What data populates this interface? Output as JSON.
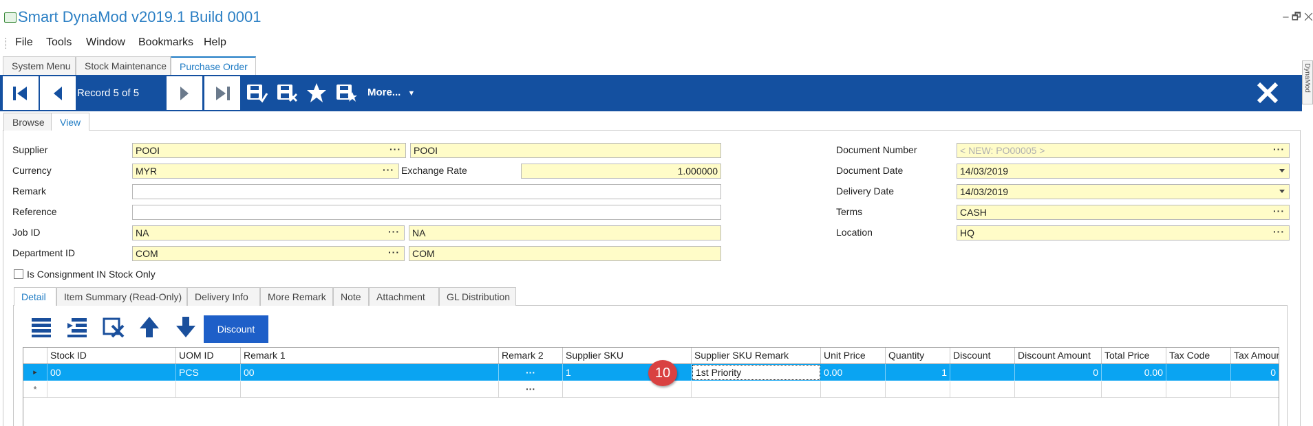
{
  "app": {
    "title": "Smart DynaMod v2019.1 Build 0001",
    "window_controls": "–  🗗  ✕"
  },
  "menu": {
    "file": "File",
    "tools": "Tools",
    "window": "Window",
    "bookmarks": "Bookmarks",
    "help": "Help"
  },
  "tabs": {
    "system_menu": "System Menu",
    "stock_maintenance": "Stock Maintenance",
    "purchase_order": "Purchase Order"
  },
  "toolbar": {
    "record_label": "Record 5 of 5",
    "more_label": "More...",
    "accent": "#1450a0"
  },
  "side_strip": {
    "label": "DynaMod"
  },
  "subtabs": {
    "browse": "Browse",
    "view": "View"
  },
  "form": {
    "supplier": {
      "label": "Supplier",
      "code": "POOI",
      "name": "POOI"
    },
    "currency": {
      "label": "Currency",
      "value": "MYR"
    },
    "exchange_rate": {
      "label": "Exchange Rate",
      "value": "1.000000"
    },
    "remark": {
      "label": "Remark",
      "value": ""
    },
    "reference": {
      "label": "Reference",
      "value": ""
    },
    "job_id": {
      "label": "Job ID",
      "code": "NA",
      "name": "NA"
    },
    "department_id": {
      "label": "Department ID",
      "code": "COM",
      "name": "COM"
    },
    "document_number": {
      "label": "Document Number",
      "value": "< NEW: PO00005 >"
    },
    "document_date": {
      "label": "Document Date",
      "value": "14/03/2019"
    },
    "delivery_date": {
      "label": "Delivery Date",
      "value": "14/03/2019"
    },
    "terms": {
      "label": "Terms",
      "value": "CASH"
    },
    "location": {
      "label": "Location",
      "value": "HQ"
    },
    "consignment": {
      "label": "Is Consignment IN Stock Only",
      "checked": false
    },
    "ellipsis": "···"
  },
  "detail_tabs": {
    "detail": "Detail",
    "item_summary": "Item Summary (Read-Only)",
    "delivery_info": "Delivery Info",
    "more_remark": "More Remark",
    "note": "Note",
    "attachment": "Attachment",
    "gl_distribution": "GL Distribution"
  },
  "grid_toolbar": {
    "discount_label": "Discount"
  },
  "grid": {
    "columns": {
      "stock_id": "Stock ID",
      "uom_id": "UOM ID",
      "remark1": "Remark 1",
      "remark2": "Remark 2",
      "supplier_sku": "Supplier SKU",
      "supplier_sku_remark": "Supplier SKU Remark",
      "unit_price": "Unit Price",
      "quantity": "Quantity",
      "discount": "Discount",
      "discount_amount": "Discount Amount",
      "total_price": "Total Price",
      "tax_code": "Tax Code",
      "tax_amount": "Tax Amour"
    },
    "row": {
      "stock_id": "00",
      "uom_id": "PCS",
      "remark1": "00",
      "remark2": "···",
      "supplier_sku": "1",
      "supplier_sku_remark": "1st Priority",
      "unit_price": "0.00",
      "quantity": "1",
      "discount": "",
      "discount_amount": "0",
      "total_price": "0.00",
      "tax_code": "",
      "tax_amount": "0"
    },
    "new_row": {
      "remark2": "···"
    },
    "row_indicator": "▸",
    "new_row_indicator": "*",
    "selection_color": "#0aa4f2"
  },
  "callout": {
    "number": "10"
  }
}
